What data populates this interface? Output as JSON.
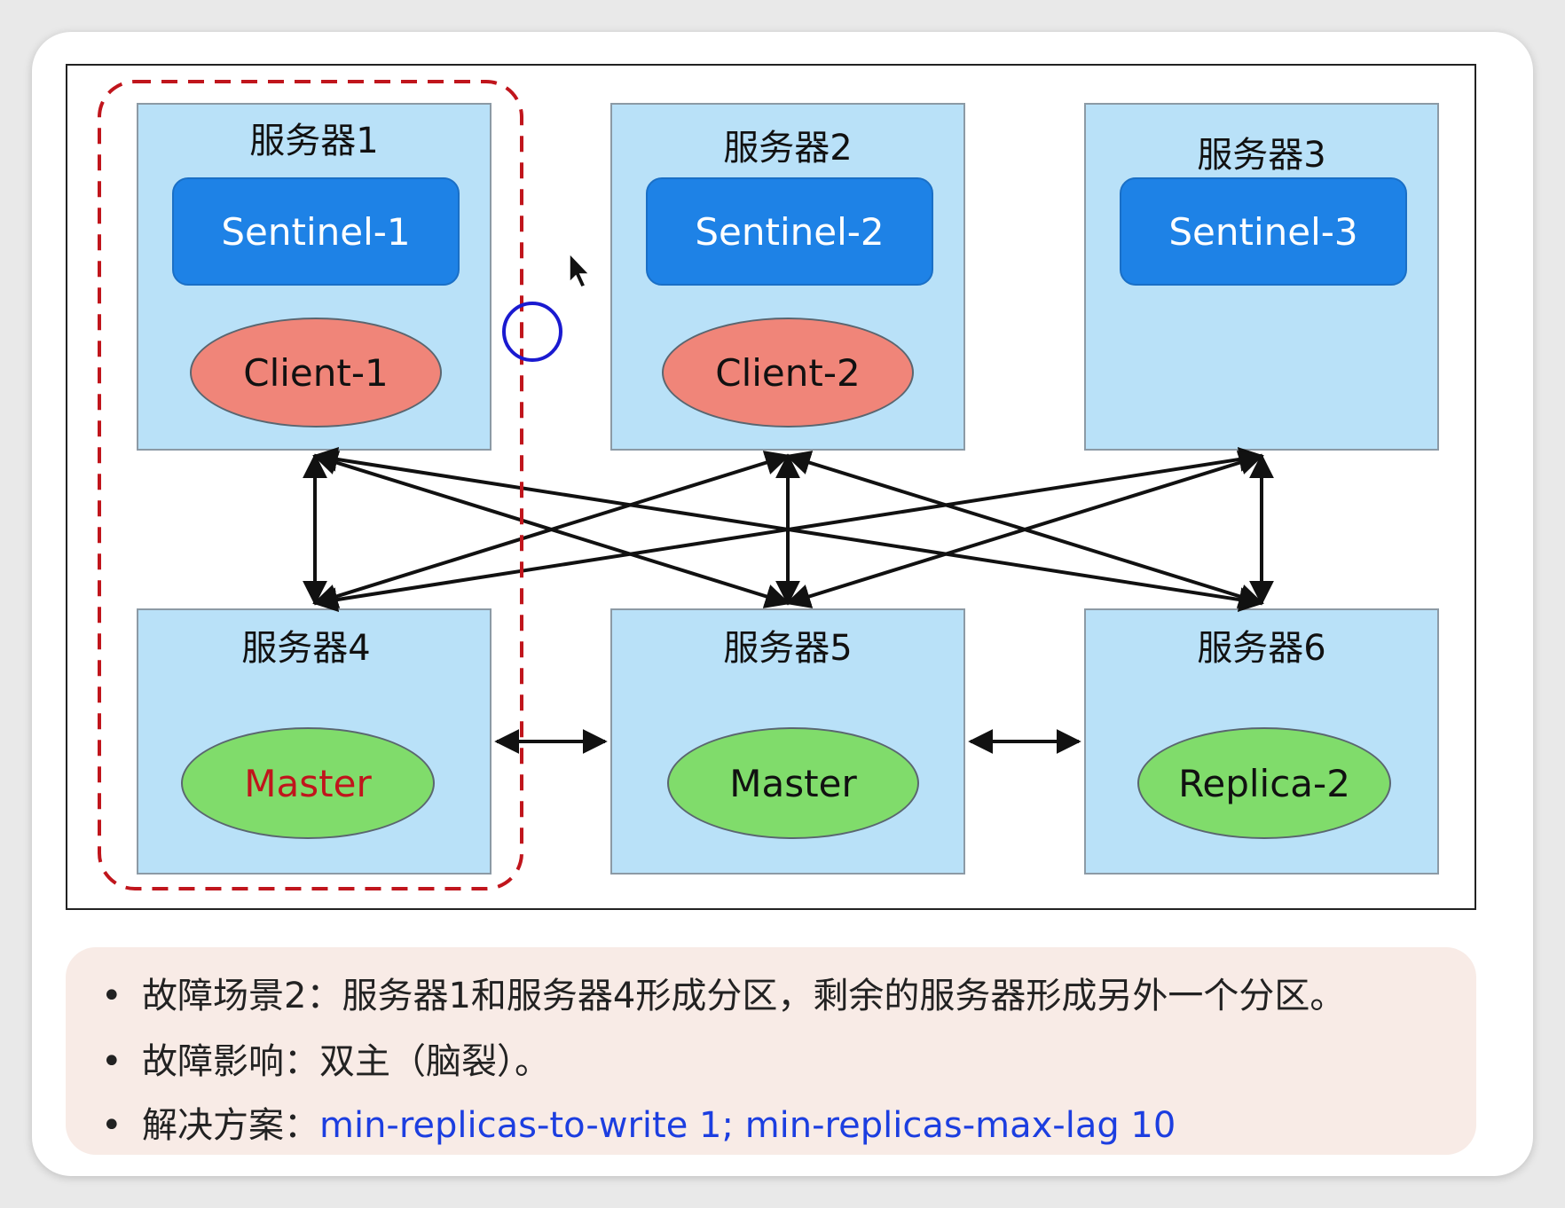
{
  "servers": {
    "s1": {
      "title": "服务器1",
      "sentinel": "Sentinel-1",
      "client": "Client-1"
    },
    "s2": {
      "title": "服务器2",
      "sentinel": "Sentinel-2",
      "client": "Client-2"
    },
    "s3": {
      "title": "服务器3",
      "sentinel": "Sentinel-3"
    },
    "s4": {
      "title": "服务器4",
      "node": "Master"
    },
    "s5": {
      "title": "服务器5",
      "node": "Master"
    },
    "s6": {
      "title": "服务器6",
      "node": "Replica-2"
    }
  },
  "colors": {
    "server_bg": "#b9e1f8",
    "sentinel": "#1e82e6",
    "client": "#f08579",
    "node": "#80dc6b",
    "partition_dash": "#c0151c",
    "stale_master_text": "#c0151c",
    "cursor_ring": "#1a1ad0",
    "solution_text": "#1c3ee0"
  },
  "notes": {
    "bullet": "•",
    "line1": "故障场景2：服务器1和服务器4形成分区，剩余的服务器形成另外一个分区。",
    "line2": "故障影响：双主（脑裂）。",
    "line3_label": "解决方案：",
    "line3_value": "min-replicas-to-write 1; min-replicas-max-lag 10"
  }
}
